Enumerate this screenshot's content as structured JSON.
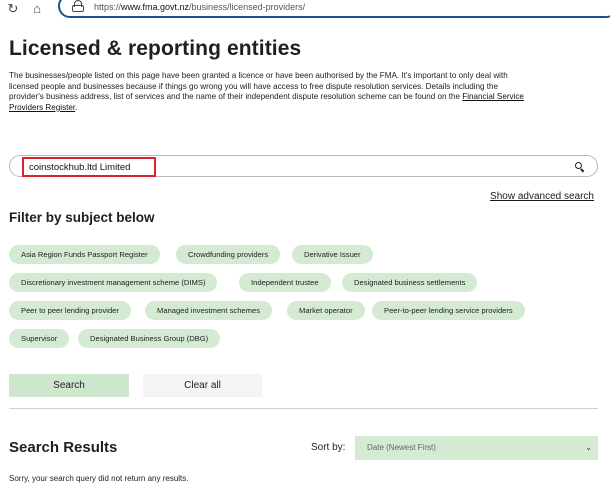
{
  "browser": {
    "url_prefix": "https://",
    "url_host": "www.fma.govt.nz",
    "url_path": "/business/licensed-providers/"
  },
  "page": {
    "title": "Licensed & reporting entities",
    "intro_text": "The businesses/people listed on this page have been granted a licence or have been authorised by the FMA. It's important to only deal with licensed people and businesses because if things go wrong you will have access to free dispute resolution services. Details including the provider's business address, list of services and the name of their independent dispute resolution scheme can be found on the ",
    "intro_link": "Financial Service Providers Register",
    "intro_end": "."
  },
  "search": {
    "value": "coinstockhub.ltd Limited",
    "advanced_link": "Show advanced search"
  },
  "filter": {
    "title": "Filter by subject below",
    "tags": [
      "Asia Region Funds Passport Register",
      "Crowdfunding providers",
      "Derivative Issuer",
      "Discretionary investment management scheme (DIMS)",
      "Independent trustee",
      "Designated business settlements",
      "Peer to peer lending provider",
      "Managed investment schemes",
      "Market operator",
      "Peer-to-peer lending service providers",
      "Supervisor",
      "Designated Business Group (DBG)"
    ]
  },
  "buttons": {
    "search": "Search",
    "clear": "Clear all"
  },
  "results": {
    "title": "Search Results",
    "sort_label": "Sort by:",
    "sort_value": "Date (Newest First)",
    "message": "Sorry, your search query did not return any results."
  }
}
